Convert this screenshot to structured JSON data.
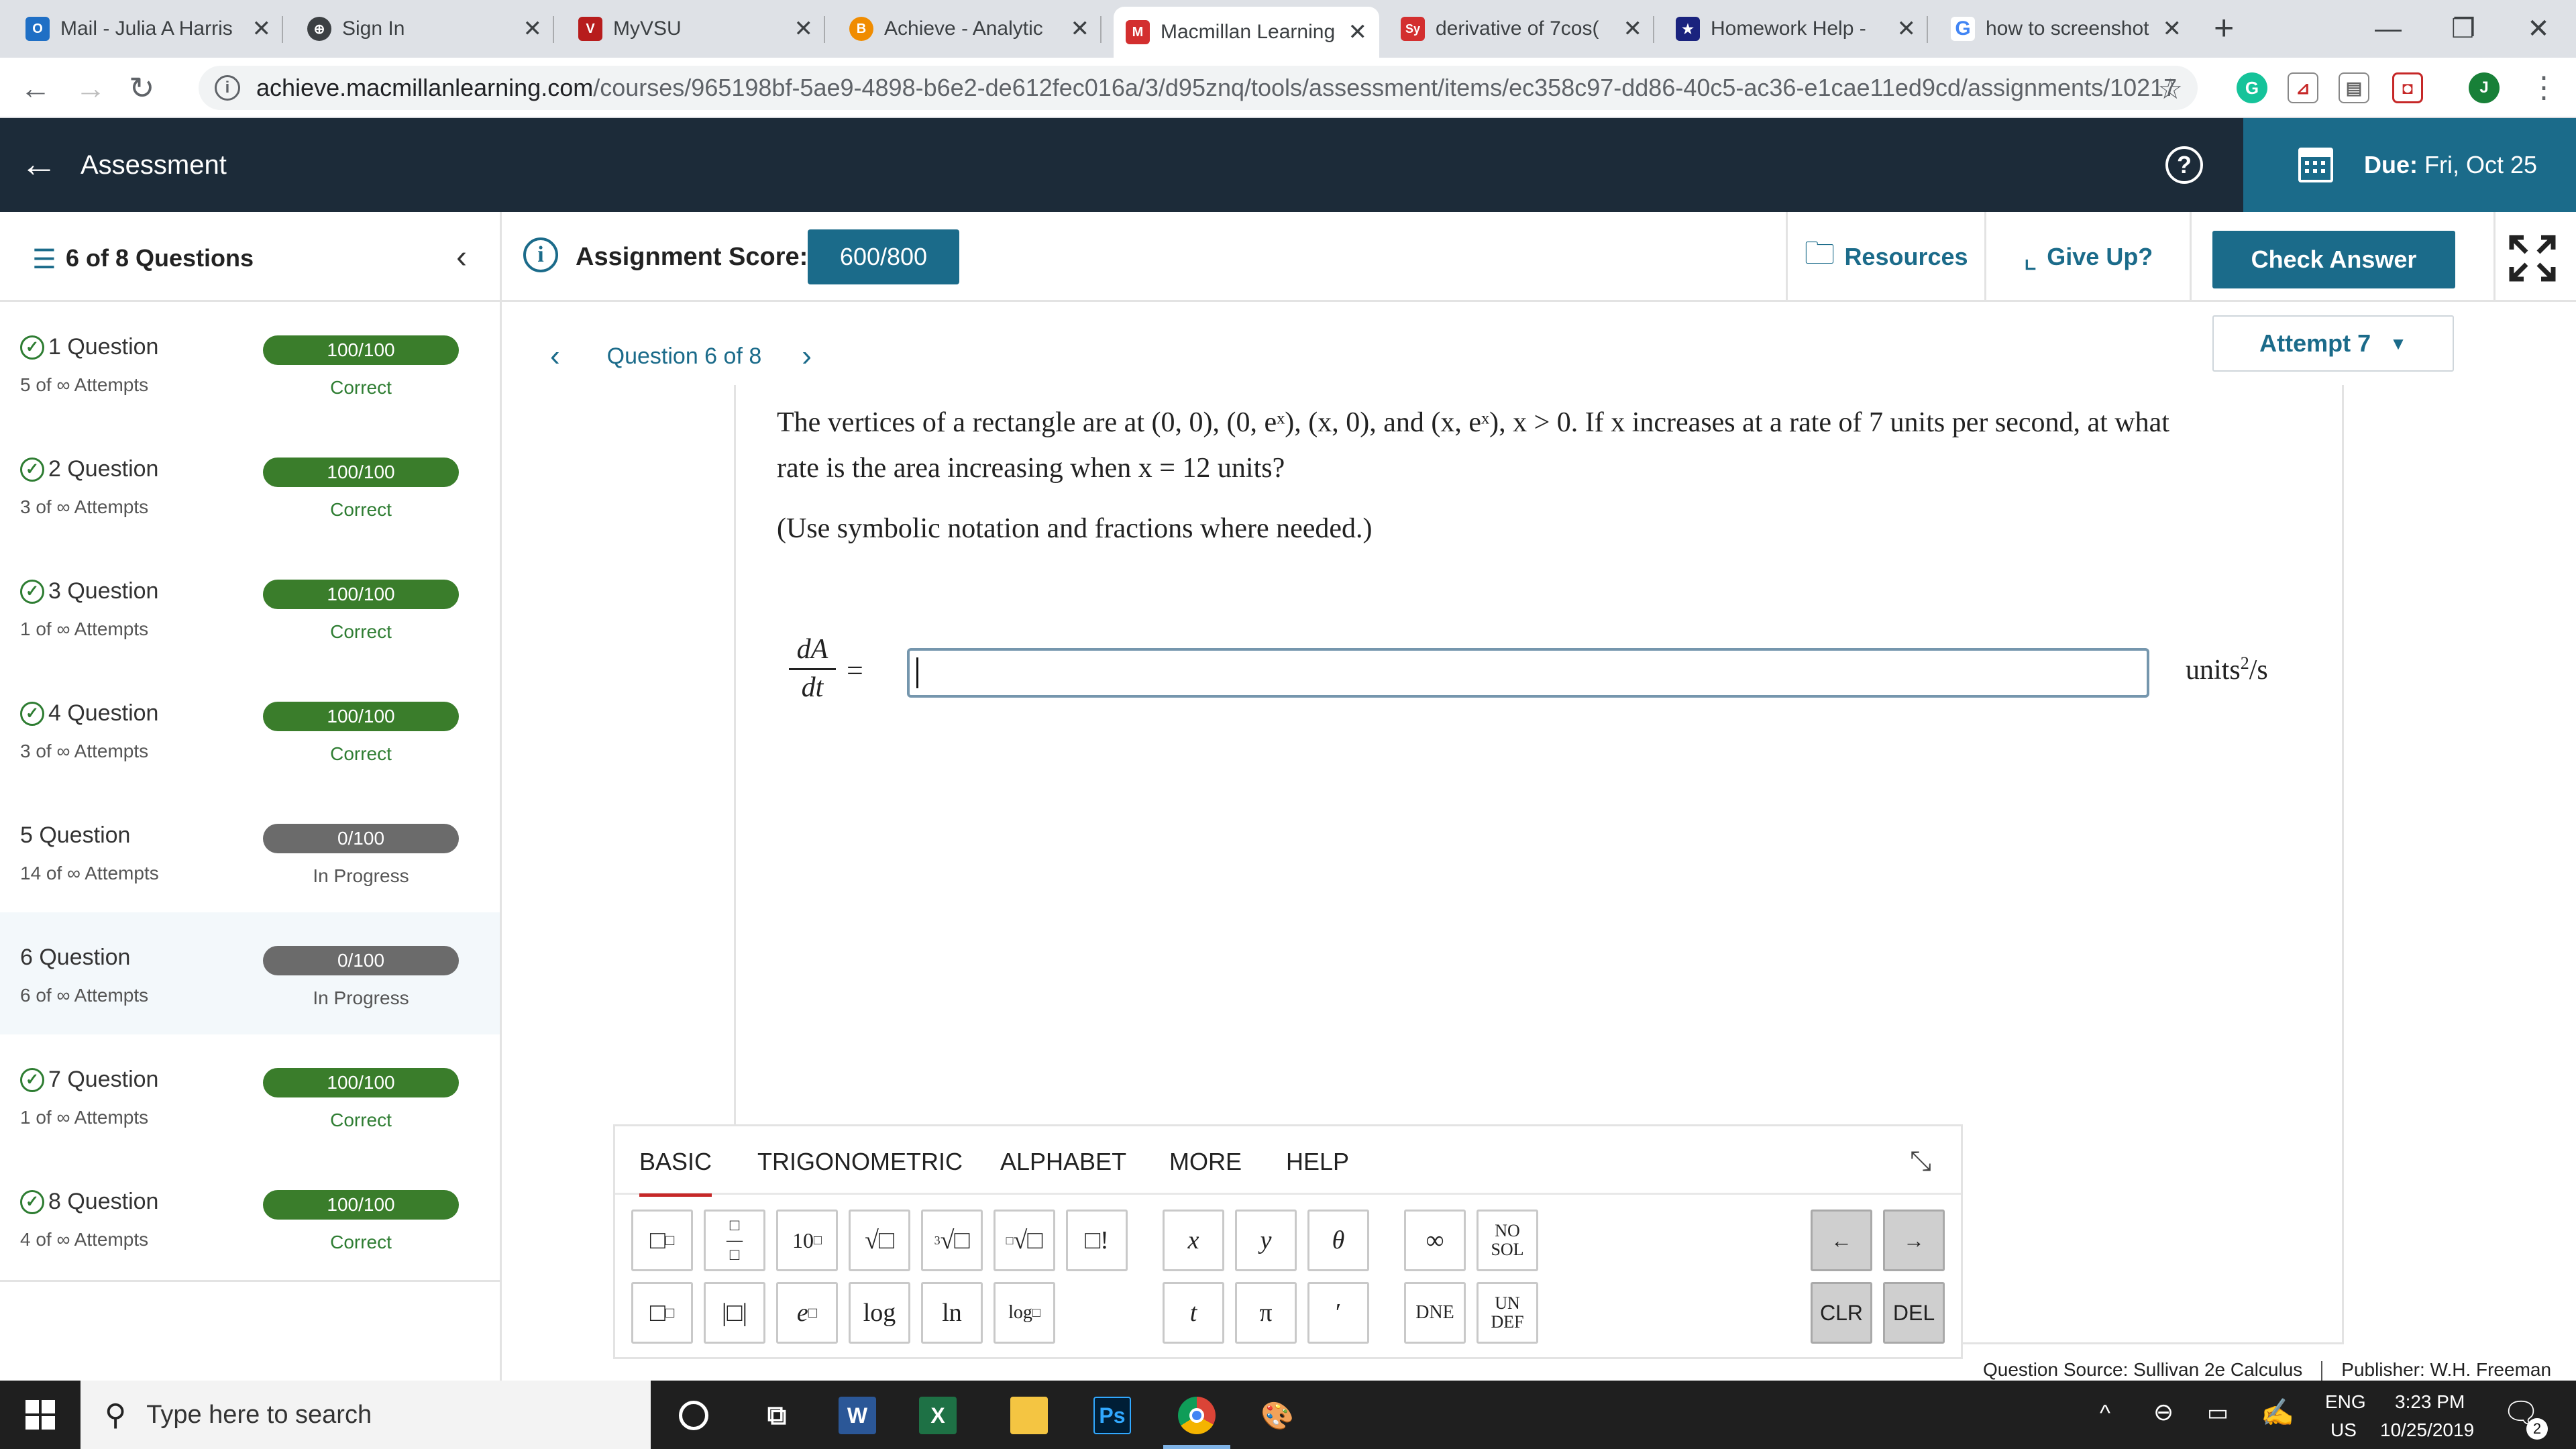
{
  "browser": {
    "tabs": [
      {
        "title": "Mail - Julia A Harris",
        "icon": "outlook-icon",
        "color": "#1f6fc5",
        "glyph": "O"
      },
      {
        "title": "Sign In",
        "icon": "sign-in-icon",
        "color": "#333333",
        "glyph": "⊕"
      },
      {
        "title": "MyVSU",
        "icon": "vsu-icon",
        "color": "#b71c1c",
        "glyph": "V"
      },
      {
        "title": "Achieve - Analytic",
        "icon": "achieve-icon",
        "color": "#f08c00",
        "glyph": "B"
      },
      {
        "title": "Macmillan Learning",
        "icon": "macmillan-icon",
        "color": "#d32f2f",
        "glyph": "M"
      },
      {
        "title": "derivative of 7cos(",
        "icon": "symbolab-icon",
        "color": "#d32f2f",
        "glyph": "Sy"
      },
      {
        "title": "Homework Help -",
        "icon": "chegg-star-icon",
        "color": "#1a237e",
        "glyph": "★"
      },
      {
        "title": "how to screenshot",
        "icon": "google-icon",
        "color": "#4285f4",
        "glyph": "G"
      }
    ],
    "active_tab": 4,
    "url_domain": "achieve.macmillanlearning.com",
    "url_path": "/courses/965198bf-5ae9-4898-b6e2-de612fec016a/3/d95znq/tools/assessment/items/ec358c97-dd86-40c5-ac36-e1cae11ed9cd/assignments/1021765...",
    "profile_initial": "J"
  },
  "header": {
    "title": "Assessment",
    "due_label": "Due:",
    "due_value": "Fri, Oct 25"
  },
  "toolbar": {
    "questions_label": "6 of 8 Questions",
    "score_label": "Assignment Score:",
    "score_value": "600/800",
    "resources_label": "Resources",
    "giveup_label": "Give Up?",
    "check_label": "Check Answer"
  },
  "questions": [
    {
      "name": "1 Question",
      "attempts": "5 of ∞ Attempts",
      "score": "100/100",
      "status": "Correct",
      "done": true
    },
    {
      "name": "2 Question",
      "attempts": "3 of ∞ Attempts",
      "score": "100/100",
      "status": "Correct",
      "done": true
    },
    {
      "name": "3 Question",
      "attempts": "1 of ∞ Attempts",
      "score": "100/100",
      "status": "Correct",
      "done": true
    },
    {
      "name": "4 Question",
      "attempts": "3 of ∞ Attempts",
      "score": "100/100",
      "status": "Correct",
      "done": true
    },
    {
      "name": "5 Question",
      "attempts": "14 of ∞ Attempts",
      "score": "0/100",
      "status": "In Progress",
      "done": false
    },
    {
      "name": "6 Question",
      "attempts": "6 of ∞ Attempts",
      "score": "0/100",
      "status": "In Progress",
      "done": false
    },
    {
      "name": "7 Question",
      "attempts": "1 of ∞ Attempts",
      "score": "100/100",
      "status": "Correct",
      "done": true
    },
    {
      "name": "8 Question",
      "attempts": "4 of ∞ Attempts",
      "score": "100/100",
      "status": "Correct",
      "done": true
    }
  ],
  "current_question_index": 5,
  "question": {
    "nav_label": "Question 6 of 8",
    "attempt_label": "Attempt 7",
    "line1": "The vertices of a rectangle are at (0, 0), (0, eˣ), (x, 0), and (x, eˣ), x > 0. If x increases at a rate of 7 units per second, at what",
    "line2": "rate is the area increasing when x = 12 units?",
    "note": "(Use symbolic notation and fractions where needed.)",
    "frac_num": "dA",
    "frac_den": "dt",
    "equals": "=",
    "answer_value": "",
    "units_base": "units",
    "units_exp": "2",
    "units_tail": "/s"
  },
  "keyboard": {
    "tabs": [
      "BASIC",
      "TRIGONOMETRIC",
      "ALPHABET",
      "MORE",
      "HELP"
    ],
    "active_tab": 0,
    "row1": [
      "□□",
      "□/□",
      "10□",
      "√□",
      "∛□",
      "ⁿ√□",
      "□!",
      "x",
      "y",
      "θ",
      "∞",
      "NO SOL"
    ],
    "row2": [
      "□□",
      "|□|",
      "e□",
      "log",
      "ln",
      "log□",
      "t",
      "π",
      "′",
      "DNE",
      "UN DEF"
    ],
    "arrows": [
      "←",
      "→"
    ],
    "clr": "CLR",
    "del": "DEL"
  },
  "footer": {
    "source": "Question Source: Sullivan 2e Calculus",
    "publisher": "Publisher: W.H. Freeman"
  },
  "taskbar": {
    "search_placeholder": "Type here to search",
    "lang1": "ENG",
    "lang2": "US",
    "time": "3:23 PM",
    "date": "10/25/2019",
    "notifications": "2"
  }
}
